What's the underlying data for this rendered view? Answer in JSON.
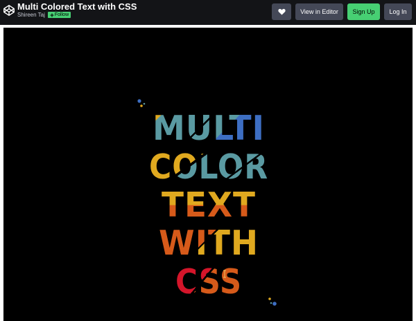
{
  "header": {
    "title": "Multi Colored Text with CSS",
    "author": "Shireen Taj",
    "follow_label": "Follow",
    "logo_icon": "codepen-logo-icon",
    "heart_icon": "heart-icon",
    "buttons": {
      "view_in_editor": "View in Editor",
      "sign_up": "Sign Up",
      "log_in": "Log In"
    }
  },
  "preview": {
    "lines": [
      "MULTI",
      "COLOR",
      "TEXT",
      "WITH",
      "CSS"
    ],
    "colors": {
      "teal": "#5a9aa2",
      "blue": "#3d6ec2",
      "gold": "#e0a91f",
      "orange": "#d65a1a",
      "red": "#d4152a",
      "background": "#000000"
    }
  },
  "colors": {
    "accent_green": "#47cf73",
    "button_gray": "#444857",
    "header_bg": "#131417"
  }
}
